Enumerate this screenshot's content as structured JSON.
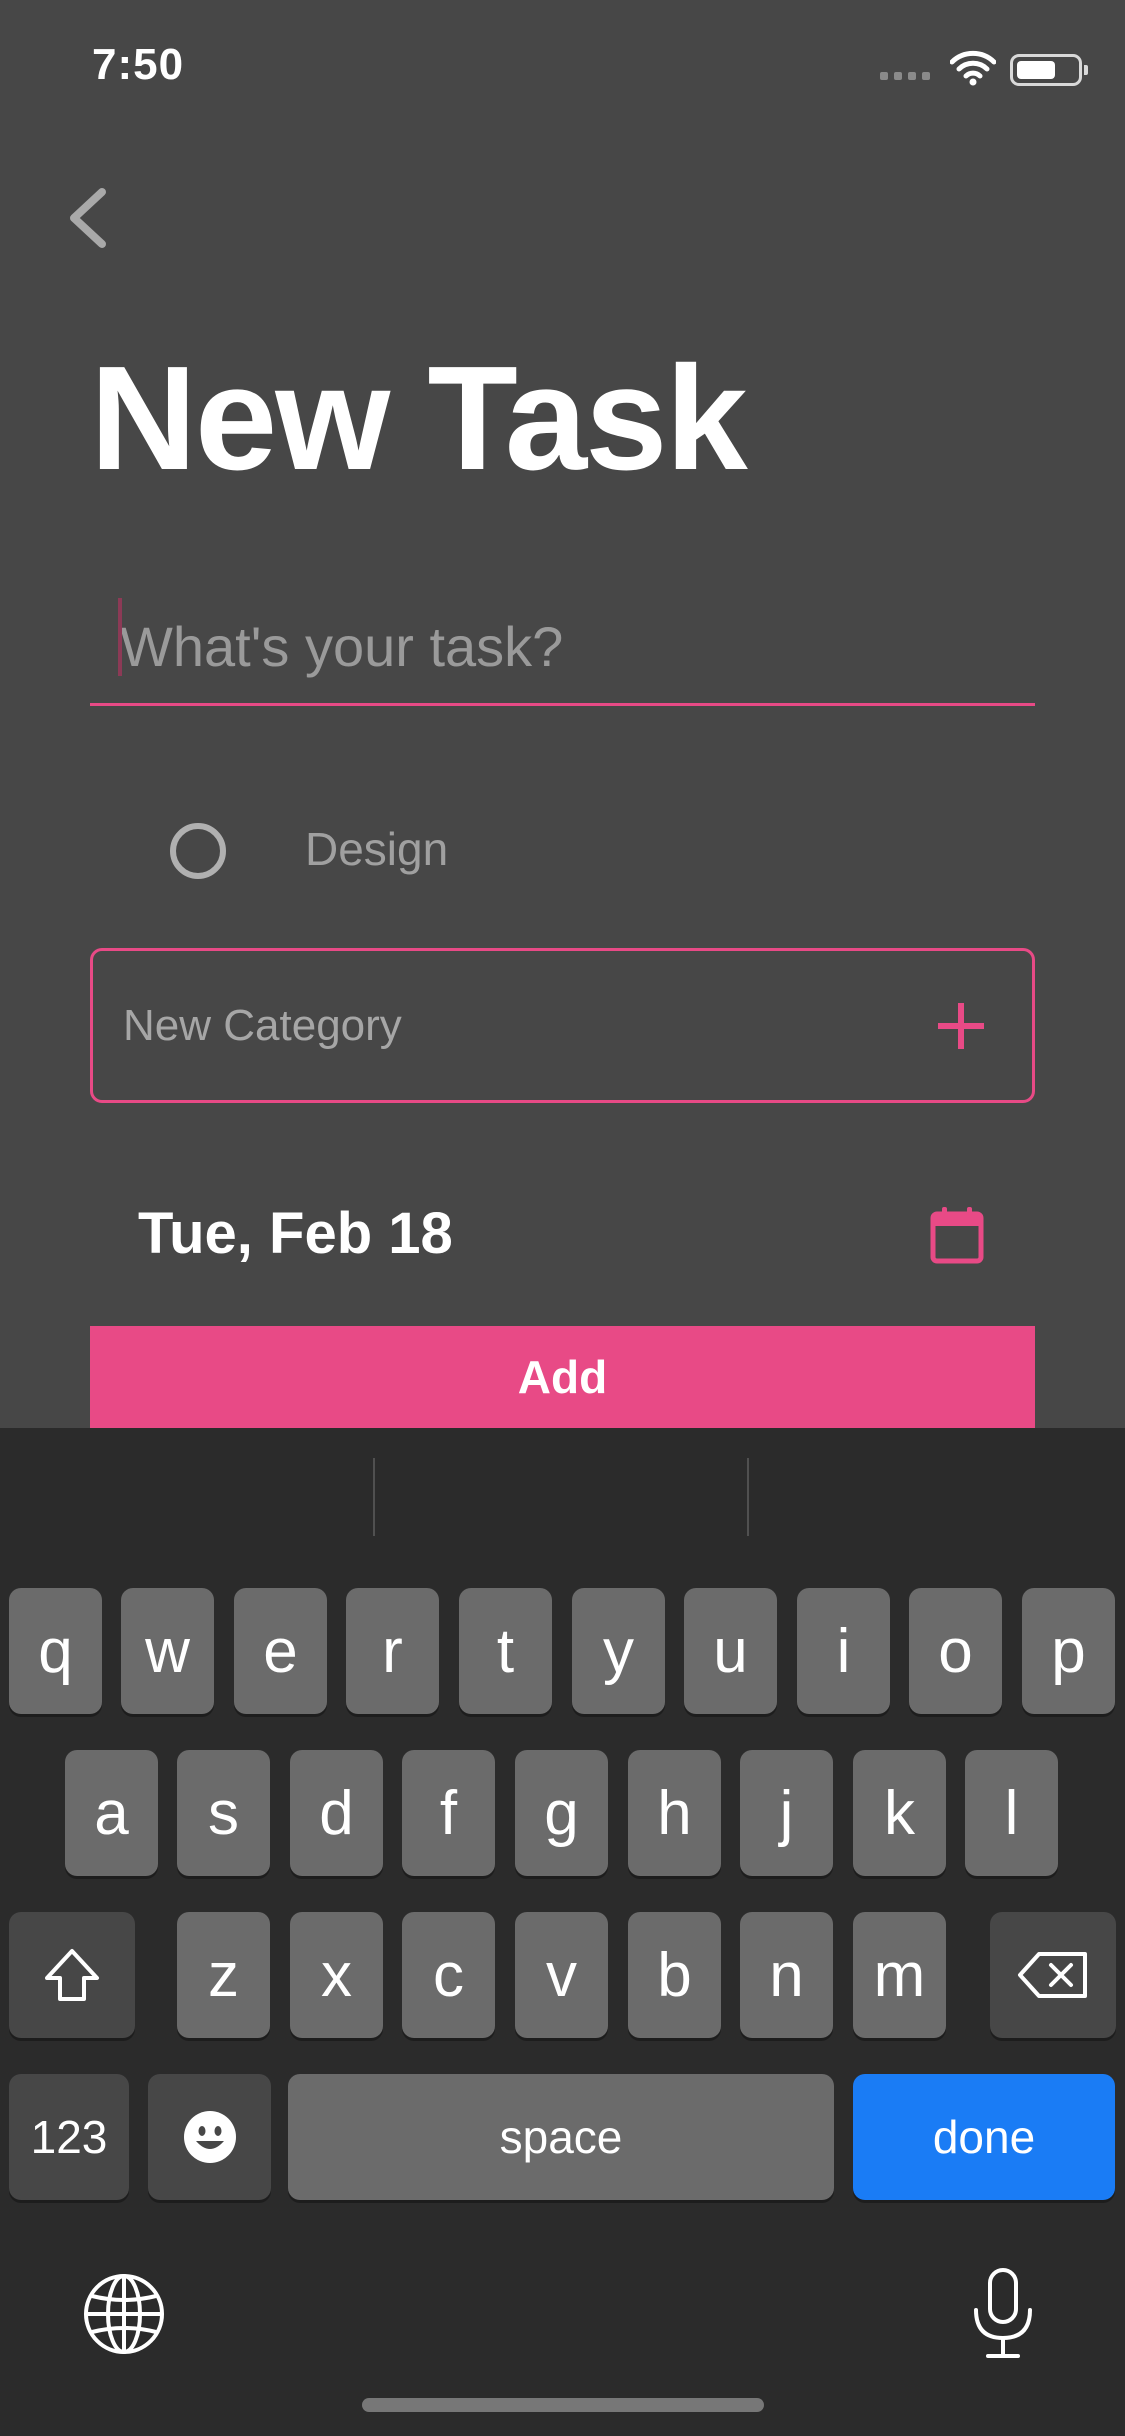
{
  "status_bar": {
    "time": "7:50"
  },
  "page": {
    "title": "New Task"
  },
  "task_input": {
    "placeholder": "What's your task?",
    "value": ""
  },
  "category": {
    "label": "Design"
  },
  "new_category": {
    "placeholder": "New Category"
  },
  "date": {
    "label": "Tue, Feb 18"
  },
  "add_button": {
    "label": "Add"
  },
  "colors": {
    "accent": "#e84a86",
    "background": "#474747",
    "done_key": "#1a7cf5"
  },
  "keyboard": {
    "row1": [
      "q",
      "w",
      "e",
      "r",
      "t",
      "y",
      "u",
      "i",
      "o",
      "p"
    ],
    "row2": [
      "a",
      "s",
      "d",
      "f",
      "g",
      "h",
      "j",
      "k",
      "l"
    ],
    "row3": [
      "z",
      "x",
      "c",
      "v",
      "b",
      "n",
      "m"
    ],
    "numbers_label": "123",
    "space_label": "space",
    "done_label": "done"
  }
}
